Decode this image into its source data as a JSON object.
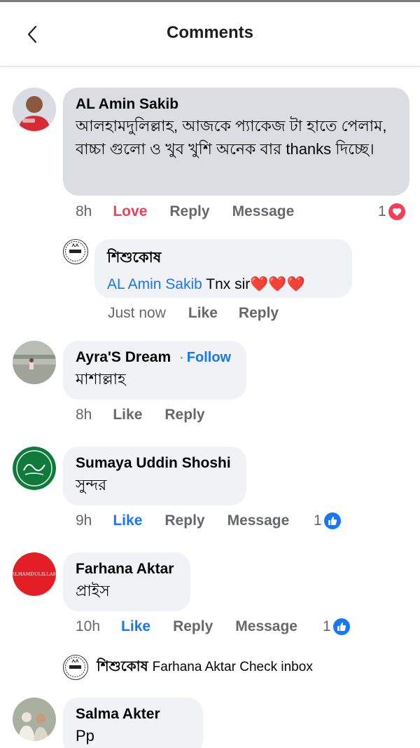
{
  "header": {
    "title": "Comments"
  },
  "comments": [
    {
      "name": "AL Amin Sakib",
      "text": "আলহামদুলিল্লাহ, আজকে প্যাকেজ টা হাতে পেলাম, বাচ্চা গুলো ও খুব খুশি অনেক বার thanks দিচ্ছে।",
      "time": "8h",
      "actions": [
        "Love",
        "Reply",
        "Message"
      ],
      "reaction_count": "1",
      "reaction_icon": "love-reaction-icon",
      "replies": [
        {
          "name": "শিশুকোষ",
          "mention": "AL Amin Sakib",
          "text": " Tnx sir❤️❤️❤️",
          "time": "Just now",
          "actions": [
            "Like",
            "Reply"
          ]
        }
      ]
    },
    {
      "name": "Ayra'S Dream",
      "follow": "Follow",
      "follow_sep": "·",
      "text": "মাশাল্লাহ",
      "time": "8h",
      "actions": [
        "Like",
        "Reply"
      ]
    },
    {
      "name": "Sumaya Uddin Shoshi",
      "text": "সুন্দর",
      "time": "9h",
      "actions": [
        "Like",
        "Reply",
        "Message"
      ],
      "reaction_count": "1",
      "reaction_icon": "like-reaction-icon"
    },
    {
      "name": "Farhana Aktar",
      "avatar_text": "ALHAMDULILLAH",
      "text": "প্রাইস",
      "time": "10h",
      "actions": [
        "Like",
        "Reply",
        "Message"
      ],
      "reaction_count": "1",
      "reaction_icon": "like-reaction-icon",
      "replies": [
        {
          "name": "শিশুকোষ",
          "text": "Farhana Aktar Check inbox"
        }
      ]
    },
    {
      "name": "Salma Akter",
      "text": "Pp"
    }
  ],
  "colors": {
    "accent": "#1877f2",
    "love": "#f33e58",
    "bubble": "#f0f2f5",
    "bubble_highlight": "#dadde1"
  }
}
